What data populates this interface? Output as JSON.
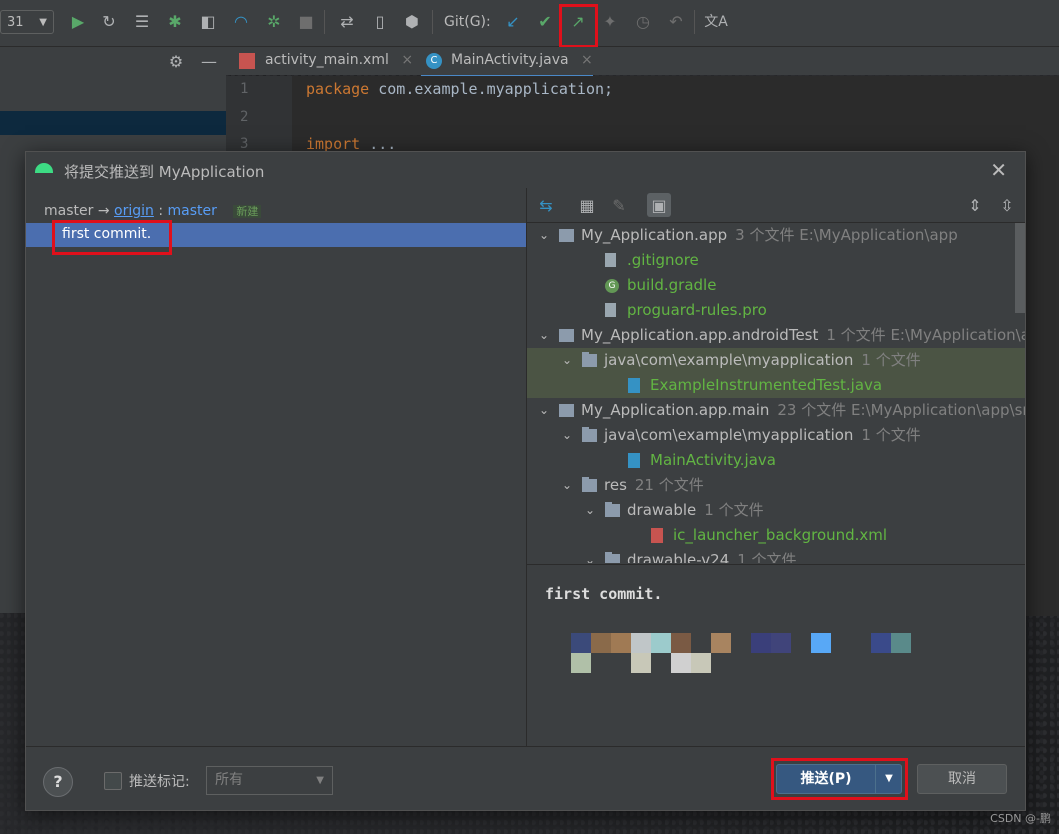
{
  "toolbar": {
    "config_value": "31",
    "git_label": "Git(G):"
  },
  "editor": {
    "tabs": [
      {
        "label": "activity_main.xml"
      },
      {
        "label": "MainActivity.java"
      }
    ],
    "lines": [
      {
        "num": "1",
        "keyword": "package",
        "rest": " com.example.myapplication;"
      },
      {
        "num": "2",
        "keyword": "",
        "rest": ""
      },
      {
        "num": "3",
        "keyword": "import",
        "rest": " ..."
      }
    ]
  },
  "dialog": {
    "title": "将提交推送到 MyApplication",
    "branch": {
      "local": "master",
      "arrow": "→",
      "remote": "origin",
      "colon": ":",
      "remote_branch": "master",
      "new_tag": "新建"
    },
    "commits": [
      {
        "message": "first commit."
      }
    ],
    "tree": [
      {
        "label": "My_Application.app",
        "meta": "3 个文件  E:\\MyApplication\\app",
        "kind": "module",
        "level": 0,
        "expanded": true
      },
      {
        "label": ".gitignore",
        "meta": "",
        "kind": "file",
        "level": 1,
        "color": "green"
      },
      {
        "label": "build.gradle",
        "meta": "",
        "kind": "gradle",
        "level": 1,
        "color": "green"
      },
      {
        "label": "proguard-rules.pro",
        "meta": "",
        "kind": "file",
        "level": 1,
        "color": "green"
      },
      {
        "label": "My_Application.app.androidTest",
        "meta": "1 个文件  E:\\MyApplication\\a",
        "kind": "module",
        "level": 0,
        "expanded": true
      },
      {
        "label": "java\\com\\example\\myapplication",
        "meta": "1 个文件",
        "kind": "folder",
        "level": 1,
        "expanded": true,
        "highlight": true
      },
      {
        "label": "ExampleInstrumentedTest.java",
        "meta": "",
        "kind": "java",
        "level": 2,
        "color": "green",
        "highlight": true
      },
      {
        "label": "My_Application.app.main",
        "meta": "23 个文件  E:\\MyApplication\\app\\sr",
        "kind": "module",
        "level": 0,
        "expanded": true
      },
      {
        "label": "java\\com\\example\\myapplication",
        "meta": "1 个文件",
        "kind": "folder",
        "level": 1,
        "expanded": true
      },
      {
        "label": "MainActivity.java",
        "meta": "",
        "kind": "java",
        "level": 2,
        "color": "green"
      },
      {
        "label": "res",
        "meta": "21 个文件",
        "kind": "folder",
        "level": 1,
        "expanded": true
      },
      {
        "label": "drawable",
        "meta": "1 个文件",
        "kind": "folder",
        "level": 2,
        "expanded": true
      },
      {
        "label": "ic_launcher_background.xml",
        "meta": "",
        "kind": "xml",
        "level": 3,
        "color": "green"
      },
      {
        "label": "drawable-v24",
        "meta": "1 个文件",
        "kind": "folder",
        "level": 2,
        "expanded": true
      }
    ],
    "detail_message": "first commit.",
    "footer": {
      "help": "?",
      "push_tags_label": "推送标记:",
      "tags_select_value": "所有",
      "push_button": "推送(P)",
      "cancel_button": "取消"
    }
  },
  "watermark": "CSDN @-鹏",
  "colors": {
    "accent": "#4b6eaf",
    "added_file": "#62b543",
    "highlight_box": "#e0101b",
    "push_button": "#365880"
  }
}
